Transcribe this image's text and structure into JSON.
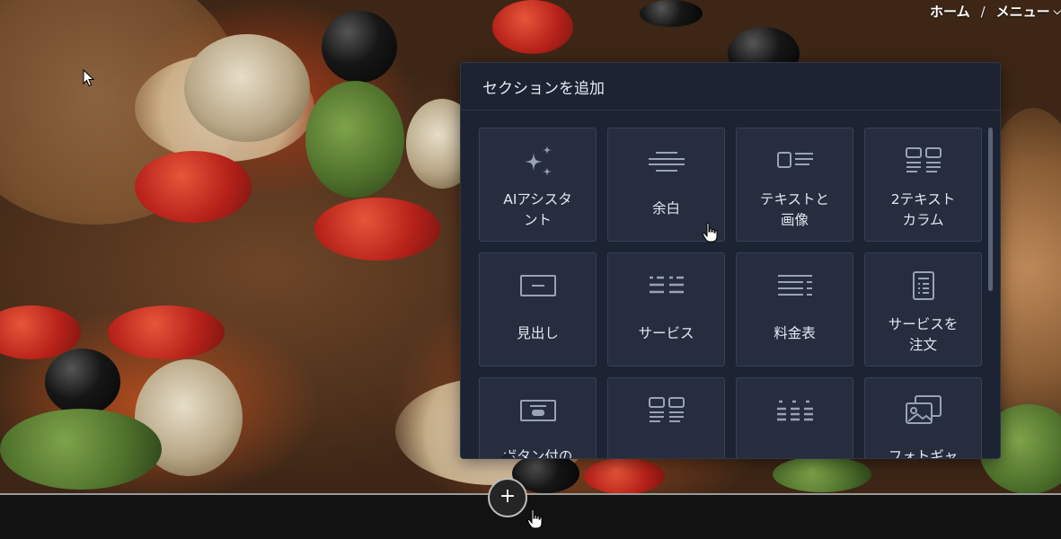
{
  "breadcrumb": {
    "home": "ホーム",
    "separator": "/",
    "menu": "メニュー"
  },
  "panel": {
    "title": "セクションを追加",
    "tiles": [
      {
        "label": "AIアシスタ\nント",
        "icon": "sparkles-icon"
      },
      {
        "label": "余白",
        "icon": "spacer-lines-icon"
      },
      {
        "label": "テキストと\n画像",
        "icon": "text-image-icon"
      },
      {
        "label": "2テキスト\nカラム",
        "icon": "two-columns-icon"
      },
      {
        "label": "見出し",
        "icon": "heading-icon"
      },
      {
        "label": "サービス",
        "icon": "services-icon"
      },
      {
        "label": "料金表",
        "icon": "price-list-icon"
      },
      {
        "label": "サービスを\n注文",
        "icon": "order-document-icon"
      },
      {
        "label": "ボタン付の",
        "icon": "button-block-icon"
      },
      {
        "label": "",
        "icon": "two-column-list-icon"
      },
      {
        "label": "",
        "icon": "three-column-list-icon"
      },
      {
        "label": "フォトギャ",
        "icon": "photo-gallery-icon"
      }
    ]
  },
  "add_button": {
    "label": "+"
  },
  "colors": {
    "panel_bg": "#1c2333",
    "tile_bg": "#252d3f",
    "tile_border": "#37405a",
    "icon": "#9aa3b5",
    "text": "#e2e6ef"
  }
}
